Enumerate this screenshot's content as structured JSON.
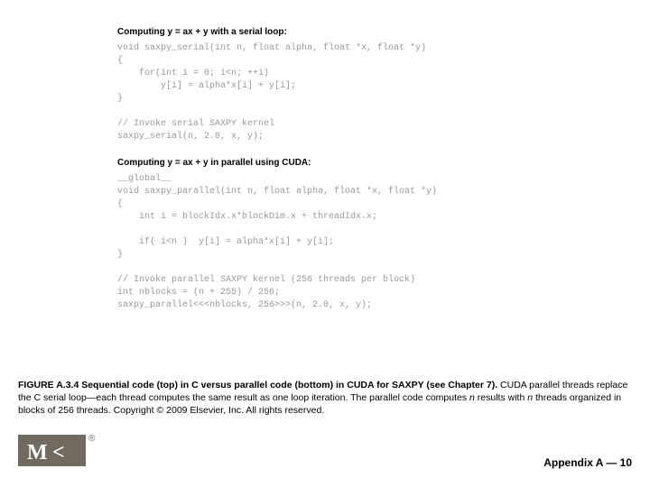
{
  "code": {
    "serial_title": "Computing y = ax + y with a serial loop:",
    "serial_code": "void saxpy_serial(int n, float alpha, float *x, float *y)\n{\n    for(int i = 0; i<n; ++i)\n        y[i] = alpha*x[i] + y[i];\n}\n\n// Invoke serial SAXPY kernel\nsaxpy_serial(n, 2.0, x, y);",
    "parallel_title": "Computing y = ax + y in parallel using CUDA:",
    "parallel_code": "__global__\nvoid saxpy_parallel(int n, float alpha, float *x, float *y)\n{\n    int i = blockIdx.x*blockDim.x + threadIdx.x;\n\n    if( i<n )  y[i] = alpha*x[i] + y[i];\n}\n\n// Invoke parallel SAXPY kernel (256 threads per block)\nint nblocks = (n + 255) / 256;\nsaxpy_parallel<<<nblocks, 256>>>(n, 2.0, x, y);"
  },
  "caption": {
    "title": "FIGURE A.3.4 Sequential code (top) in C versus parallel code (bottom) in CUDA for SAXPY (see Chapter 7).",
    "body_pre": "CUDA parallel threads replace the C serial loop—each thread computes the same result as one loop iteration. The parallel code computes ",
    "n1": "n",
    "body_mid": " results with ",
    "n2": "n",
    "body_post": " threads organized in blocks of 256 threads. Copyright © 2009 Elsevier, Inc. All rights reserved."
  },
  "footer": "Appendix A — 10"
}
